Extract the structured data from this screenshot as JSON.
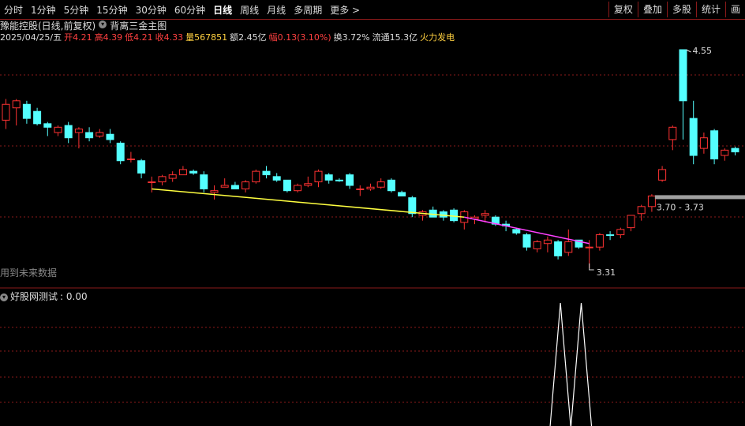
{
  "toolbar": {
    "periods": [
      "分时",
      "1分钟",
      "5分钟",
      "15分钟",
      "30分钟",
      "60分钟",
      "日线",
      "周线",
      "月线",
      "多周期",
      "更多 >"
    ],
    "active_period": "日线",
    "right_buttons": [
      "复权",
      "叠加",
      "多股",
      "统计",
      "画"
    ]
  },
  "stock": {
    "name_line": "豫能控股(日线,前复权)",
    "indicator_icon": "info-circle-icon",
    "indicator_name": "背离三金主图"
  },
  "quote": {
    "date": "2025/04/25/五",
    "open_label": "开",
    "open": "4.21",
    "high_label": "高",
    "high": "4.39",
    "low_label": "低",
    "low": "4.21",
    "close_label": "收",
    "close": "4.33",
    "vol_label": "量",
    "vol": "567851",
    "amount_label": "额",
    "amount": "2.45亿",
    "change_label": "幅",
    "change": "0.13(3.10%)",
    "turnover_label": "换",
    "turnover": "3.72%",
    "float_label": "流通",
    "float": "15.3亿",
    "signal": "火力发电"
  },
  "annotations": {
    "high_price": "4.55",
    "low_price": "3.31",
    "range": "3.70 - 3.73"
  },
  "hint_text": "用到未来数据",
  "sub_panel": {
    "title": "好股网测试",
    "value": ": 0.00"
  },
  "colors": {
    "up": "#ff3232",
    "down": "#54ffff",
    "support_line": "#ffff40",
    "divergence_line": "#ff40ff",
    "grid": "#8b1a1a"
  },
  "chart_data": {
    "type": "candlestick",
    "price_high_labeled": 4.55,
    "price_low_labeled": 3.31,
    "candles": [
      {
        "o": 4.15,
        "h": 4.27,
        "l": 4.1,
        "c": 4.24,
        "up": true
      },
      {
        "o": 4.22,
        "h": 4.27,
        "l": 4.12,
        "c": 4.26,
        "up": true
      },
      {
        "o": 4.24,
        "h": 4.26,
        "l": 4.13,
        "c": 4.16,
        "up": false
      },
      {
        "o": 4.2,
        "h": 4.22,
        "l": 4.12,
        "c": 4.13,
        "up": false
      },
      {
        "o": 4.13,
        "h": 4.14,
        "l": 4.06,
        "c": 4.11,
        "up": false
      },
      {
        "o": 4.08,
        "h": 4.12,
        "l": 4.06,
        "c": 4.11,
        "up": true
      },
      {
        "o": 4.12,
        "h": 4.14,
        "l": 4.02,
        "c": 4.05,
        "up": false
      },
      {
        "o": 4.1,
        "h": 4.11,
        "l": 3.99,
        "c": 4.08,
        "up": true
      },
      {
        "o": 4.08,
        "h": 4.11,
        "l": 4.03,
        "c": 4.05,
        "up": false
      },
      {
        "o": 4.06,
        "h": 4.1,
        "l": 4.05,
        "c": 4.08,
        "up": true
      },
      {
        "o": 4.07,
        "h": 4.1,
        "l": 4.02,
        "c": 4.04,
        "up": false
      },
      {
        "o": 4.02,
        "h": 4.03,
        "l": 3.9,
        "c": 3.92,
        "up": false
      },
      {
        "o": 3.93,
        "h": 3.97,
        "l": 3.91,
        "c": 3.93,
        "up": true
      },
      {
        "o": 3.92,
        "h": 3.93,
        "l": 3.82,
        "c": 3.85,
        "up": false
      },
      {
        "o": 3.8,
        "h": 3.83,
        "l": 3.74,
        "c": 3.8,
        "up": true
      },
      {
        "o": 3.8,
        "h": 3.84,
        "l": 3.78,
        "c": 3.83,
        "up": true
      },
      {
        "o": 3.82,
        "h": 3.86,
        "l": 3.8,
        "c": 3.84,
        "up": true
      },
      {
        "o": 3.84,
        "h": 3.89,
        "l": 3.84,
        "c": 3.87,
        "up": true
      },
      {
        "o": 3.86,
        "h": 3.87,
        "l": 3.84,
        "c": 3.85,
        "up": false
      },
      {
        "o": 3.84,
        "h": 3.86,
        "l": 3.74,
        "c": 3.76,
        "up": false
      },
      {
        "o": 3.74,
        "h": 3.78,
        "l": 3.7,
        "c": 3.75,
        "up": true
      },
      {
        "o": 3.77,
        "h": 3.82,
        "l": 3.77,
        "c": 3.78,
        "up": true
      },
      {
        "o": 3.78,
        "h": 3.8,
        "l": 3.76,
        "c": 3.76,
        "up": false
      },
      {
        "o": 3.76,
        "h": 3.81,
        "l": 3.74,
        "c": 3.8,
        "up": true
      },
      {
        "o": 3.8,
        "h": 3.87,
        "l": 3.79,
        "c": 3.86,
        "up": true
      },
      {
        "o": 3.86,
        "h": 3.89,
        "l": 3.82,
        "c": 3.84,
        "up": false
      },
      {
        "o": 3.83,
        "h": 3.85,
        "l": 3.8,
        "c": 3.81,
        "up": false
      },
      {
        "o": 3.81,
        "h": 3.81,
        "l": 3.74,
        "c": 3.75,
        "up": false
      },
      {
        "o": 3.75,
        "h": 3.79,
        "l": 3.74,
        "c": 3.78,
        "up": true
      },
      {
        "o": 3.78,
        "h": 3.83,
        "l": 3.77,
        "c": 3.79,
        "up": true
      },
      {
        "o": 3.8,
        "h": 3.87,
        "l": 3.77,
        "c": 3.86,
        "up": true
      },
      {
        "o": 3.84,
        "h": 3.85,
        "l": 3.79,
        "c": 3.81,
        "up": false
      },
      {
        "o": 3.81,
        "h": 3.82,
        "l": 3.8,
        "c": 3.81,
        "up": false
      },
      {
        "o": 3.84,
        "h": 3.85,
        "l": 3.76,
        "c": 3.78,
        "up": false
      },
      {
        "o": 3.76,
        "h": 3.78,
        "l": 3.72,
        "c": 3.76,
        "up": true
      },
      {
        "o": 3.76,
        "h": 3.79,
        "l": 3.75,
        "c": 3.77,
        "up": true
      },
      {
        "o": 3.77,
        "h": 3.82,
        "l": 3.76,
        "c": 3.8,
        "up": true
      },
      {
        "o": 3.81,
        "h": 3.82,
        "l": 3.74,
        "c": 3.75,
        "up": false
      },
      {
        "o": 3.74,
        "h": 3.75,
        "l": 3.72,
        "c": 3.72,
        "up": false
      },
      {
        "o": 3.71,
        "h": 3.72,
        "l": 3.6,
        "c": 3.62,
        "up": false
      },
      {
        "o": 3.61,
        "h": 3.64,
        "l": 3.58,
        "c": 3.63,
        "up": true
      },
      {
        "o": 3.64,
        "h": 3.66,
        "l": 3.6,
        "c": 3.6,
        "up": false
      },
      {
        "o": 3.63,
        "h": 3.64,
        "l": 3.58,
        "c": 3.6,
        "up": false
      },
      {
        "o": 3.64,
        "h": 3.65,
        "l": 3.57,
        "c": 3.58,
        "up": false
      },
      {
        "o": 3.57,
        "h": 3.64,
        "l": 3.53,
        "c": 3.63,
        "up": true
      },
      {
        "o": 3.59,
        "h": 3.61,
        "l": 3.56,
        "c": 3.6,
        "up": true
      },
      {
        "o": 3.61,
        "h": 3.64,
        "l": 3.57,
        "c": 3.62,
        "up": true
      },
      {
        "o": 3.6,
        "h": 3.61,
        "l": 3.55,
        "c": 3.56,
        "up": false
      },
      {
        "o": 3.56,
        "h": 3.58,
        "l": 3.52,
        "c": 3.55,
        "up": false
      },
      {
        "o": 3.53,
        "h": 3.54,
        "l": 3.5,
        "c": 3.51,
        "up": false
      },
      {
        "o": 3.5,
        "h": 3.51,
        "l": 3.41,
        "c": 3.43,
        "up": false
      },
      {
        "o": 3.42,
        "h": 3.47,
        "l": 3.4,
        "c": 3.46,
        "up": true
      },
      {
        "o": 3.45,
        "h": 3.49,
        "l": 3.4,
        "c": 3.47,
        "up": true
      },
      {
        "o": 3.46,
        "h": 3.47,
        "l": 3.36,
        "c": 3.38,
        "up": false
      },
      {
        "o": 3.4,
        "h": 3.53,
        "l": 3.38,
        "c": 3.46,
        "up": true
      },
      {
        "o": 3.47,
        "h": 3.47,
        "l": 3.42,
        "c": 3.43,
        "up": false
      },
      {
        "o": 3.43,
        "h": 3.47,
        "l": 3.31,
        "c": 3.43,
        "up": true
      },
      {
        "o": 3.43,
        "h": 3.51,
        "l": 3.41,
        "c": 3.5,
        "up": true
      },
      {
        "o": 3.5,
        "h": 3.52,
        "l": 3.47,
        "c": 3.5,
        "up": false
      },
      {
        "o": 3.5,
        "h": 3.54,
        "l": 3.48,
        "c": 3.53,
        "up": true
      },
      {
        "o": 3.54,
        "h": 3.61,
        "l": 3.52,
        "c": 3.61,
        "up": true
      },
      {
        "o": 3.62,
        "h": 3.67,
        "l": 3.58,
        "c": 3.66,
        "up": true
      },
      {
        "o": 3.66,
        "h": 3.73,
        "l": 3.63,
        "c": 3.72,
        "up": true
      },
      {
        "o": 3.81,
        "h": 3.89,
        "l": 3.8,
        "c": 3.87,
        "up": true
      },
      {
        "o": 4.04,
        "h": 4.12,
        "l": 3.98,
        "c": 4.11,
        "up": true
      },
      {
        "o": 4.55,
        "h": 4.55,
        "l": 4.04,
        "c": 4.26,
        "up": false
      },
      {
        "o": 4.16,
        "h": 4.26,
        "l": 3.9,
        "c": 3.95,
        "up": false
      },
      {
        "o": 3.99,
        "h": 4.08,
        "l": 3.96,
        "c": 4.05,
        "up": true
      },
      {
        "o": 4.09,
        "h": 4.1,
        "l": 3.9,
        "c": 3.93,
        "up": false
      },
      {
        "o": 3.95,
        "h": 3.99,
        "l": 3.92,
        "c": 3.98,
        "up": true
      },
      {
        "o": 3.99,
        "h": 4.0,
        "l": 3.95,
        "c": 3.97,
        "up": false
      }
    ],
    "support_line": {
      "from_index": 14,
      "to_index": 44,
      "from_price": 3.76,
      "to_price": 3.6
    },
    "divergence_line": {
      "from_index": 44,
      "to_index": 56,
      "from_price": 3.6,
      "to_price": 3.45
    },
    "sub_indicator_spikes": [
      53,
      55
    ]
  }
}
